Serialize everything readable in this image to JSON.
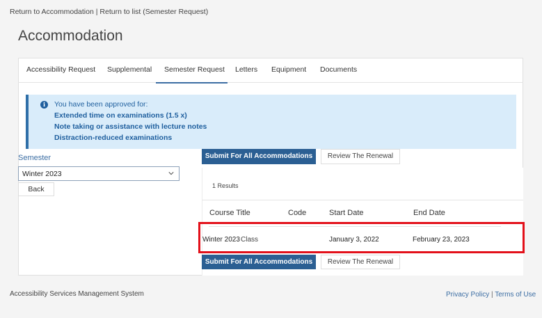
{
  "breadcrumb": {
    "return_accommodation": "Return to Accommodation",
    "separator": "|",
    "return_list": "Return to list (Semester Request)"
  },
  "page": {
    "title": "Accommodation"
  },
  "tabs": [
    {
      "label": "Accessibility Request"
    },
    {
      "label": "Supplemental"
    },
    {
      "label": "Semester Request",
      "active": true
    },
    {
      "label": "Letters"
    },
    {
      "label": "Equipment"
    },
    {
      "label": "Documents"
    }
  ],
  "info": {
    "icon": "info-icon",
    "lead": "You have been approved for:",
    "items": [
      "Extended time on examinations (1.5 x)",
      "Note taking or assistance with lecture notes",
      "Distraction-reduced examinations"
    ]
  },
  "semester": {
    "label": "Semester",
    "selected": "Winter 2023",
    "back_label": "Back"
  },
  "actions": {
    "submit_all": "Submit For All Accommodations",
    "review_renewal": "Review The Renewal"
  },
  "results": {
    "count_text": "1 Results",
    "columns": [
      "Course Title",
      "Code",
      "Start Date",
      "End Date"
    ],
    "rows": [
      {
        "course_title": "Winter 2023",
        "course_type": "Class",
        "code": "",
        "start_date": "January 3, 2022",
        "end_date": "February 23, 2023"
      }
    ]
  },
  "footer": {
    "system_name": "Accessibility Services Management System",
    "privacy": "Privacy Policy",
    "separator": "|",
    "terms": "Terms of Use"
  },
  "colors": {
    "primary": "#2b5f93",
    "info_bg": "#d9ecfa",
    "info_text": "#1f5f9e",
    "highlight": "#e3101a"
  }
}
